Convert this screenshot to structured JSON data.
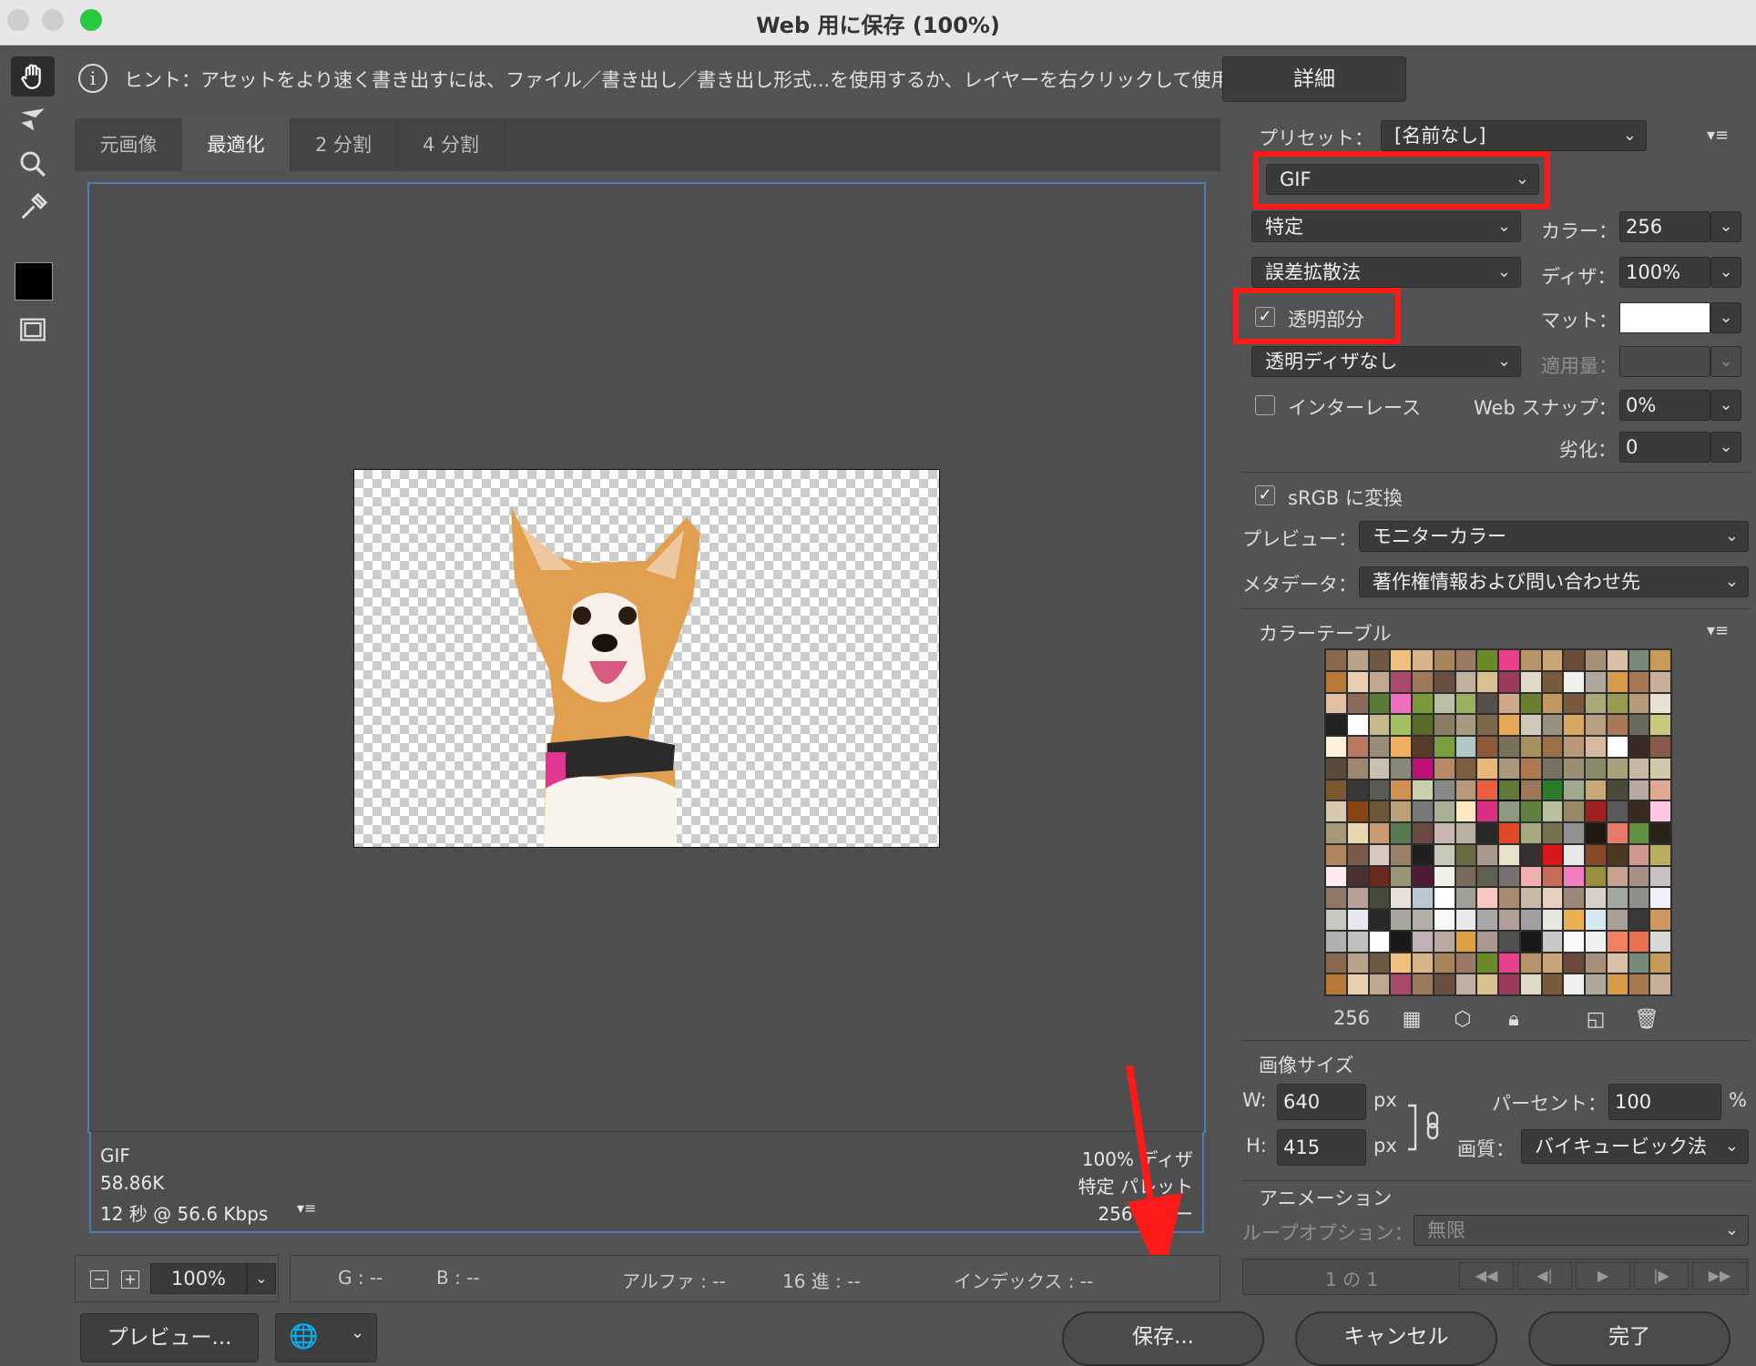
{
  "window": {
    "title": "Web 用に保存 (100%)"
  },
  "hint": {
    "text": "ヒント：アセットをより速く書き出すには、ファイル／書き出し／書き出し形式...を使用するか、レイヤーを右クリックして使用。",
    "detail_button": "詳細"
  },
  "tabs": [
    "元画像",
    "最適化",
    "2 分割",
    "4 分割"
  ],
  "info_left": {
    "format": "GIF",
    "size": "58.86K",
    "time": "12 秒 @ 56.6 Kbps"
  },
  "info_right": {
    "line1": "100% ディザ",
    "line2": "特定 パレット",
    "line3": "256 カラー"
  },
  "zoom": {
    "value": "100%"
  },
  "status": {
    "g": "G : --",
    "b": "B : --",
    "alpha": "アルファ : --",
    "hex": "16 進 : --",
    "index": "インデックス : --"
  },
  "buttons": {
    "preview": "プレビュー...",
    "save": "保存...",
    "cancel": "キャンセル",
    "done": "完了"
  },
  "settings": {
    "preset_label": "プリセット：",
    "preset_value": "[名前なし]",
    "format": "GIF",
    "palette": "特定",
    "colors_label": "カラー：",
    "colors_value": "256",
    "dither_method": "誤差拡散法",
    "dither_label": "ディザ：",
    "dither_value": "100%",
    "transparency_label": "透明部分",
    "transparency_checked": true,
    "matte_label": "マット：",
    "matte_color": "#ffffff",
    "transparency_dither": "透明ディザなし",
    "amount_label": "適用量：",
    "interlace_label": "インターレース",
    "interlace_checked": false,
    "websnap_label": "Web スナップ：",
    "websnap_value": "0%",
    "lossy_label": "劣化：",
    "lossy_value": "0",
    "srgb_label": "sRGB に変換",
    "srgb_checked": true,
    "preview_label": "プレビュー：",
    "preview_value": "モニターカラー",
    "metadata_label": "メタデータ：",
    "metadata_value": "著作権情報および問い合わせ先"
  },
  "color_table": {
    "title": "カラーテーブル",
    "count": "256",
    "colors": [
      "#8a6a4e",
      "#b8a48a",
      "#6e5a44",
      "#f0c080",
      "#d8b48a",
      "#a8845c",
      "#9a7a62",
      "#6a8a2a",
      "#e8408a",
      "#b8946a",
      "#c8a478",
      "#6a4a3a",
      "#a89078",
      "#d8c0a8",
      "#7a8a7a",
      "#c89a58",
      "#b87838",
      "#e8d0b0",
      "#c0a890",
      "#a84a6a",
      "#9c7a5a",
      "#6a5040",
      "#c0b0a0",
      "#d8c090",
      "#9c3a5a",
      "#e0d8c8",
      "#7a5a3a",
      "#f0f0f0",
      "#b0a89c",
      "#d89a48",
      "#a87850",
      "#c8b098",
      "#e0c0a0",
      "#8a6a58",
      "#5a7a3a",
      "#f070c0",
      "#7a9a3a",
      "#b8c0a8",
      "#98b060",
      "#585048",
      "#d0a888",
      "#6a8030",
      "#c09860",
      "#7a5840",
      "#a8a878",
      "#9a9a52",
      "#b89a78",
      "#e8e0d0",
      "#222222",
      "#ffffff",
      "#c8b890",
      "#a0c060",
      "#5a6a2a",
      "#8c7c64",
      "#a89a82",
      "#7a6848",
      "#e8a858",
      "#d0c8b8",
      "#9a9080",
      "#d8a860",
      "#b8a080",
      "#a87858",
      "#6a6a5a",
      "#c8c880",
      "#fff0d8",
      "#b87a60",
      "#9a8a7a",
      "#f0b060",
      "#5a3a2a",
      "#7aa040",
      "#b0c8c8",
      "#8a5a3a",
      "#787058",
      "#a89060",
      "#9a7048",
      "#b89878",
      "#d8b8a0",
      "#ffffff",
      "#3a2a22",
      "#8a5a48",
      "#5a4a3a",
      "#a08870",
      "#c8c0b0",
      "#888878",
      "#c0107a",
      "#b88a6a",
      "#7a6040",
      "#e8b878",
      "#a8987c",
      "#b07a50",
      "#787060",
      "#989070",
      "#8a8a6a",
      "#a8a07a",
      "#c8b8a8",
      "#d0c8a8",
      "#7a5830",
      "#383838",
      "#5a5a52",
      "#d09050",
      "#c8d0b0",
      "#888888",
      "#b89878",
      "#e86040",
      "#607838",
      "#9a7858",
      "#2a7a2a",
      "#a0a890",
      "#c8a878",
      "#4a4a3a",
      "#b8a8a0",
      "#e0a890",
      "#d8c8b0",
      "#884410",
      "#6a5838",
      "#b8a078",
      "#787878",
      "#a8b098",
      "#ffe8c0",
      "#d83080",
      "#909880",
      "#608040",
      "#b8c0a0",
      "#988868",
      "#a02020",
      "#5a5a5a",
      "#3a2a20",
      "#ffc8e0",
      "#a89878",
      "#e8d8b0",
      "#c89a70",
      "#587850",
      "#6a4a40",
      "#c8b8b0",
      "#b8b0a0",
      "#282828",
      "#e04828",
      "#a8a880",
      "#787050",
      "#909090",
      "#201810",
      "#e87a6a",
      "#609040",
      "#282418",
      "#b08860",
      "#7a5a48",
      "#d8c8c0",
      "#9a8068",
      "#202020",
      "#c8c8b8",
      "#6a6a40",
      "#a89890",
      "#e8e0c8",
      "#383030",
      "#d81818",
      "#e8e8e8",
      "#884828",
      "#4a3820",
      "#d09890",
      "#b8b060",
      "#ffe8f0",
      "#4a3030",
      "#6a2a20",
      "#989878",
      "#501838",
      "#f0f0e8",
      "#7a6858",
      "#606050",
      "#787070",
      "#f0b0b0",
      "#c86a58",
      "#f080c0",
      "#989040",
      "#c8a090",
      "#a89088",
      "#c8c0c0",
      "#907868",
      "#b8a098",
      "#484838",
      "#e8e0d8",
      "#b8c8d0",
      "#ffffff",
      "#a0a098",
      "#f8c8c0",
      "#a88a70",
      "#c8b8a8",
      "#e8d0c0",
      "#9a8878",
      "#d8d0c8",
      "#a0a8a0",
      "#909088",
      "#f0f0f8",
      "#c8c8c0",
      "#e8e8f0",
      "#282828",
      "#a8a8a0",
      "#b0b0a8",
      "#f8f8f8",
      "#e8e8e8",
      "#a8a8a8",
      "#b0a098",
      "#a0a0a0",
      "#e8e8e0",
      "#e8b050",
      "#d8e8f0",
      "#a8a098",
      "#383838",
      "#d09860",
      "#b0b0b0",
      "#c0c0c0",
      "#ffffff",
      "#181818",
      "#c0b0b8",
      "#b8a8a0",
      "#e0a040",
      "#a89890",
      "#505050",
      "#181818",
      "#c8c8c8",
      "#f8f8f8",
      "#f0f0f0",
      "#f08060",
      "#e87050",
      "#d8d8d8"
    ]
  },
  "image_size": {
    "title": "画像サイズ",
    "w_label": "W:",
    "w_value": "640",
    "w_unit": "px",
    "h_label": "H:",
    "h_value": "415",
    "h_unit": "px",
    "percent_label": "パーセント：",
    "percent_value": "100",
    "percent_unit": "%",
    "quality_label": "画質：",
    "quality_value": "バイキュービック法"
  },
  "animation": {
    "title": "アニメーション",
    "loop_label": "ループオプション：",
    "loop_value": "無限",
    "frame_counter": "1 の 1"
  },
  "colors": {
    "highlight": "#ff1a1a",
    "selection_border": "#4a7fb3",
    "arrow": "#ff1a1a"
  }
}
